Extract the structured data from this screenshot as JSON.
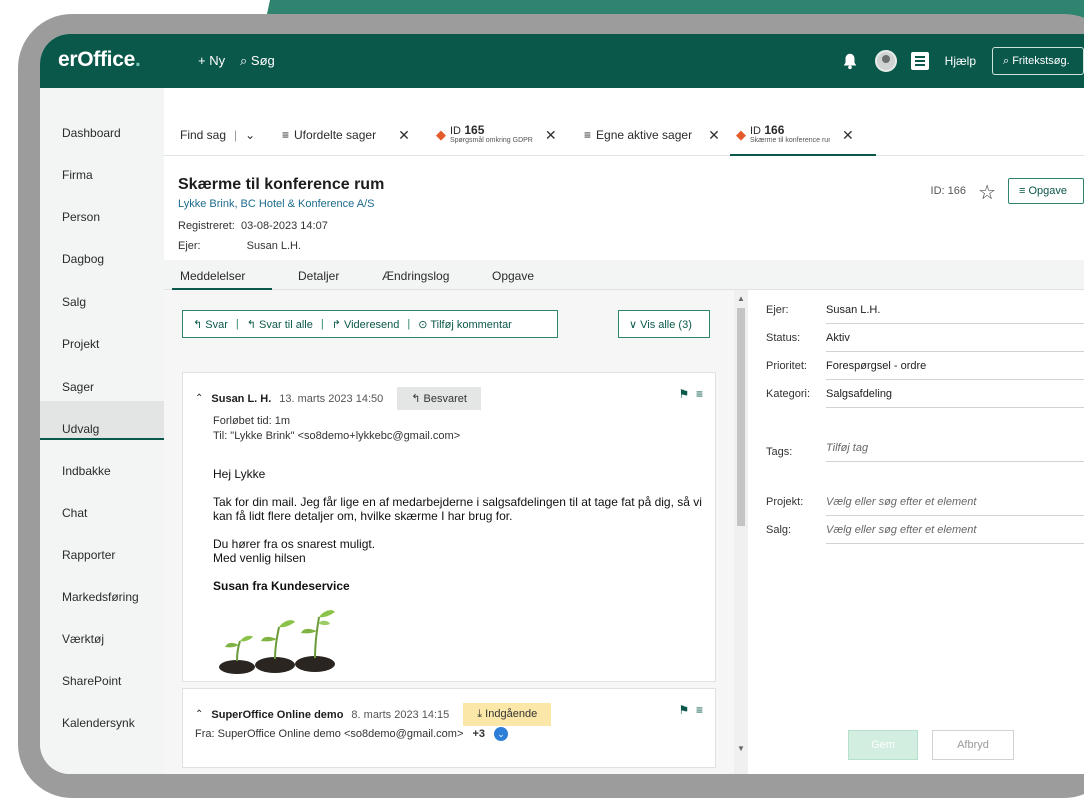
{
  "topbar": {
    "logo": "erOffice",
    "logo_dot": ".",
    "new_label": "+ Ny",
    "search_label": "⌕ Søg",
    "help_label": "Hjælp",
    "freetext_label": "⌕ Fritekstsøg.",
    "icons": [
      "bell-icon",
      "avatar",
      "document-icon",
      "search-icon"
    ]
  },
  "sidebar": {
    "items": [
      "Dashboard",
      "Firma",
      "Person",
      "Dagbog",
      "Salg",
      "Projekt",
      "Sager",
      "Udvalg",
      "Indbakke",
      "Chat",
      "Rapporter",
      "Markedsføring",
      "Værktøj",
      "SharePoint",
      "Kalendersynk"
    ],
    "active": "Sager"
  },
  "tabs": {
    "find": "Find sag",
    "t1": "Ufordelte sager",
    "t2_id_prefix": "ID",
    "t2_id": "165",
    "t2_sub": "Spørgsmål omkring GDPR",
    "t3": "Egne aktive sager",
    "t4_id_prefix": "ID",
    "t4_id": "166",
    "t4_sub": "Skærme til konference rum"
  },
  "case": {
    "title": "Skærme til konference rum",
    "company": "Lykke Brink, BC Hotel & Konference A/S",
    "registered_label": "Registreret:",
    "registered": "03-08-2023 14:07",
    "owner_label": "Ejer:",
    "owner": "Susan L.H.",
    "id_label": "ID: 166",
    "task_button": "≡ Opgave"
  },
  "subtabs": [
    "Meddelelser",
    "Detaljer",
    "Ændringslog",
    "Opgave"
  ],
  "actions": {
    "reply": "↰ Svar",
    "reply_all": "↰ Svar til alle",
    "forward": "↱ Videresend",
    "comment": "⊙ Tilføj kommentar",
    "show_all": "∨ Vis alle (3)"
  },
  "messages": [
    {
      "name": "Susan L. H.",
      "date": "13. marts 2023 14:50",
      "badge": "↰ Besvaret",
      "elapsed": "Forløbet tid: 1m",
      "to": "Til: \"Lykke Brink\" <so8demo+lykkebc@gmail.com>",
      "greeting": "Hej Lykke",
      "body1": "Tak for din mail. Jeg får lige en af medarbejderne i salgsafdelingen til at tage fat på dig, så vi kan få lidt flere detaljer om, hvilke skærme I har brug for.",
      "body2": "Du hører fra os snarest muligt.",
      "body3": "Med venlig hilsen",
      "signature": "Susan fra Kundeservice"
    },
    {
      "name": "SuperOffice Online demo",
      "date": "8. marts 2023 14:15",
      "badge": "⤓ Indgående",
      "from": "Fra: SuperOffice Online demo <so8demo@gmail.com>",
      "more": "+3"
    }
  ],
  "details": {
    "owner_label": "Ejer:",
    "owner": "Susan L.H.",
    "status_label": "Status:",
    "status": "Aktiv",
    "priority_label": "Prioritet:",
    "priority": "Forespørgsel - ordre",
    "category_label": "Kategori:",
    "category": "Salgsafdeling",
    "tags_label": "Tags:",
    "tags_placeholder": "Tilføj tag",
    "project_label": "Projekt:",
    "project_placeholder": "Vælg eller søg efter et element",
    "sale_label": "Salg:",
    "sale_placeholder": "Vælg eller søg efter et element"
  },
  "buttons": {
    "save": "Gem",
    "cancel": "Afbryd"
  },
  "colors": {
    "brand": "#0a584a",
    "accent": "#2f8470",
    "ticket": "#e45a2a",
    "answered": "#e4e6e5",
    "incoming": "#fbe7a7"
  }
}
